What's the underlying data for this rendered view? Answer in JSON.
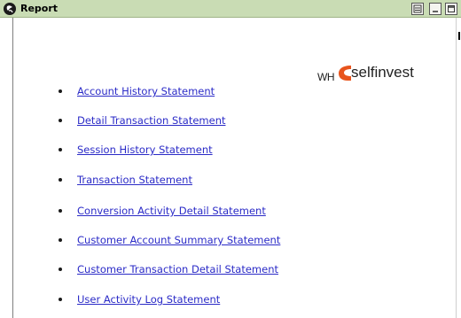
{
  "window": {
    "title": "Report",
    "icon": "app-icon",
    "controls": [
      "minimize-restore-icon",
      "minimize-icon",
      "maximize-icon"
    ]
  },
  "logo": {
    "prefix": "WH",
    "name": "selfinvest",
    "accent_color": "#e8541c"
  },
  "links": [
    {
      "label": "Account History Statement"
    },
    {
      "label": "Detail Transaction Statement"
    },
    {
      "label": "Session History Statement"
    },
    {
      "label": "Transaction Statement"
    },
    {
      "label": "Conversion Activity Detail Statement"
    },
    {
      "label": "Customer Account Summary Statement"
    },
    {
      "label": "Customer Transaction Detail Statement"
    },
    {
      "label": "User Activity Log Statement"
    }
  ],
  "colors": {
    "titlebar": "#c9dcb4",
    "link": "#2b2bc7"
  }
}
